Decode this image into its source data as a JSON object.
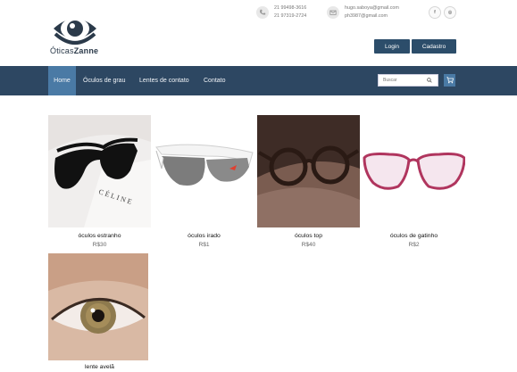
{
  "brand": {
    "name_prefix": "Óticas",
    "name_suffix": "Zanne"
  },
  "contacts": [
    {
      "icon": "phone-icon",
      "lines": [
        "21 99498-3616",
        "21 97319-2724"
      ]
    },
    {
      "icon": "email-icon",
      "lines": [
        "hugo.saboya@gmail.com",
        "ph3987@gmail.com"
      ]
    }
  ],
  "social": [
    {
      "icon": "facebook-icon",
      "glyph": "f"
    },
    {
      "icon": "instagram-icon",
      "glyph": "◎"
    }
  ],
  "auth": {
    "login": "Login",
    "register": "Cadastro"
  },
  "nav": {
    "items": [
      "Home",
      "Óculos de grau",
      "Lentes de contato",
      "Contato"
    ],
    "active_index": 0,
    "search_placeholder": "Buscar"
  },
  "products": [
    {
      "name": "óculos estranho",
      "price": "R$30",
      "image": "sunglasses-celine"
    },
    {
      "name": "óculos irado",
      "price": "R$1",
      "image": "sport-sunglasses-white"
    },
    {
      "name": "óculos top",
      "price": "R$40",
      "image": "round-glasses-tortoise"
    },
    {
      "name": "óculos de gatinho",
      "price": "R$2",
      "image": "cat-eye-glasses-pink"
    },
    {
      "name": "lente avelã",
      "price": "",
      "image": "hazel-eye-contact-lens"
    }
  ],
  "colors": {
    "nav_bg": "#2d4762",
    "nav_active": "#4a7aa5",
    "button": "#2c4d6a"
  }
}
